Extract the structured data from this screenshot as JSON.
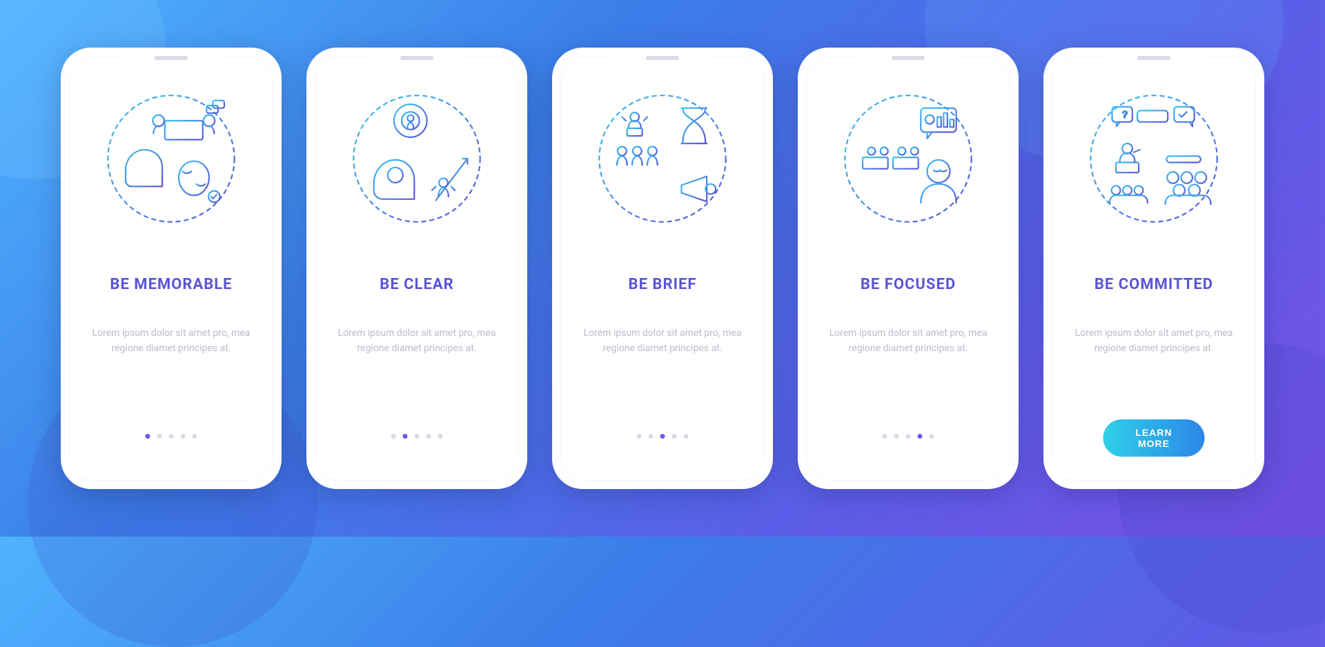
{
  "colors": {
    "title": "#5a54d6",
    "body": "#b7bcc9",
    "dot_inactive": "#d8dbe6",
    "dot_active": "#6a5be8",
    "cta_gradient_from": "#2fd0e8",
    "cta_gradient_to": "#2b87e8",
    "stroke_gradient_from": "#36c4f2",
    "stroke_gradient_to": "#5a54d6"
  },
  "common_body": "Lorem ipsum dolor sit amet pro, mea regione diamet principes at.",
  "screens": [
    {
      "title": "BE MEMORABLE",
      "icon": "memorable-icon",
      "active_dot": 0,
      "has_cta": false
    },
    {
      "title": "BE CLEAR",
      "icon": "clear-icon",
      "active_dot": 1,
      "has_cta": false
    },
    {
      "title": "BE BRIEF",
      "icon": "brief-icon",
      "active_dot": 2,
      "has_cta": false
    },
    {
      "title": "BE FOCUSED",
      "icon": "focused-icon",
      "active_dot": 3,
      "has_cta": false
    },
    {
      "title": "BE COMMITTED",
      "icon": "committed-icon",
      "active_dot": 4,
      "has_cta": true
    }
  ],
  "dot_count": 5,
  "cta_label": "LEARN MORE"
}
